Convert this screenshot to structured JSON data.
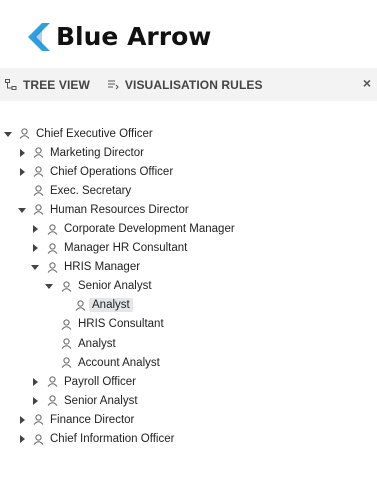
{
  "brand": {
    "name": "Blue Arrow",
    "accent": "#2f9fe0"
  },
  "tabs": [
    {
      "label": "TREE VIEW",
      "icon": "tree-view-icon"
    },
    {
      "label": "VISUALISATION RULES",
      "icon": "rules-icon"
    }
  ],
  "close_label": "×",
  "tree": [
    {
      "label": "Chief Executive Officer",
      "level": 0,
      "state": "expanded"
    },
    {
      "label": "Marketing Director",
      "level": 1,
      "state": "collapsed"
    },
    {
      "label": "Chief Operations Officer",
      "level": 1,
      "state": "collapsed"
    },
    {
      "label": "Exec. Secretary",
      "level": 1,
      "state": "leaf"
    },
    {
      "label": "Human Resources Director",
      "level": 1,
      "state": "expanded"
    },
    {
      "label": "Corporate Development Manager",
      "level": 2,
      "state": "collapsed"
    },
    {
      "label": "Manager HR Consultant",
      "level": 2,
      "state": "collapsed"
    },
    {
      "label": "HRIS Manager",
      "level": 2,
      "state": "expanded"
    },
    {
      "label": "Senior Analyst",
      "level": 3,
      "state": "expanded"
    },
    {
      "label": "Analyst",
      "level": 4,
      "state": "leaf",
      "selected": true
    },
    {
      "label": "HRIS Consultant",
      "level": 3,
      "state": "leaf"
    },
    {
      "label": "Analyst",
      "level": 3,
      "state": "leaf"
    },
    {
      "label": "Account Analyst",
      "level": 3,
      "state": "leaf"
    },
    {
      "label": "Payroll Officer",
      "level": 2,
      "state": "collapsed"
    },
    {
      "label": "Senior Analyst",
      "level": 2,
      "state": "collapsed"
    },
    {
      "label": "Finance Director",
      "level": 1,
      "state": "collapsed"
    },
    {
      "label": "Chief Information Officer",
      "level": 1,
      "state": "collapsed"
    }
  ]
}
